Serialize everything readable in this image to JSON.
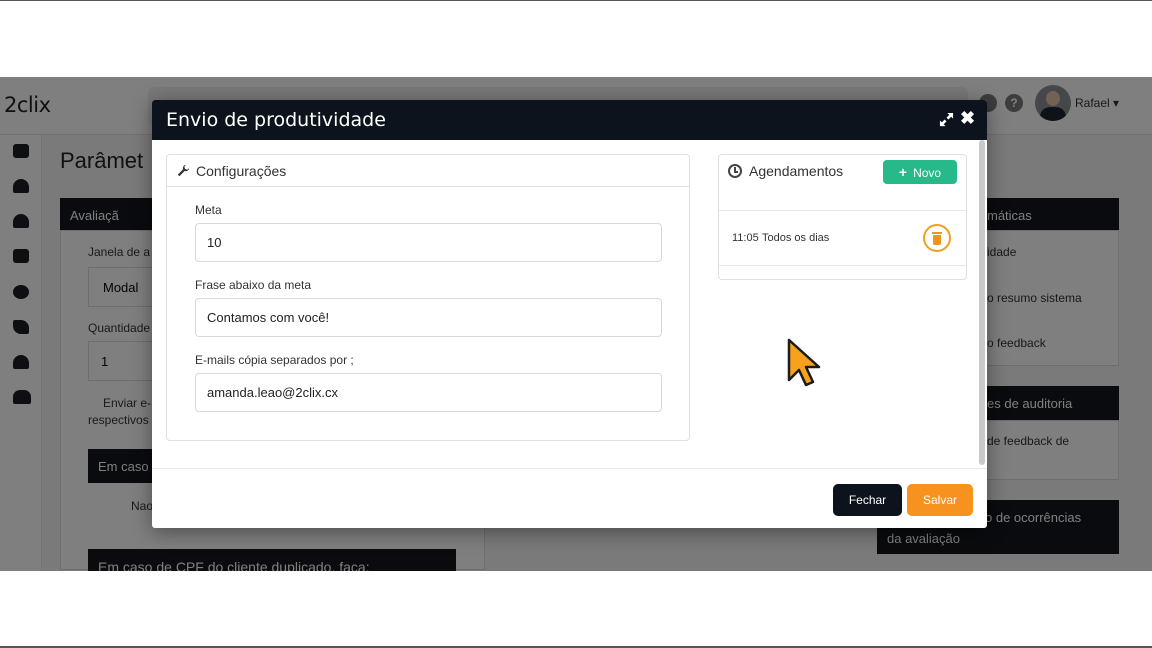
{
  "app": {
    "logo": "2clix",
    "user_name": "Rafael ▾",
    "page_title": "Parâmet",
    "help_icon": "?"
  },
  "background": {
    "left_panel_head": "Avaliaçã",
    "left_label_1": "Janela de a",
    "left_select_value": "Modal",
    "left_label_2": "Quantidade",
    "left_input_value": "1",
    "left_checkbox_text_1": "Enviar e-",
    "left_checkbox_text_2": "respectivos",
    "left_sub_head": "Em caso",
    "left_radio_label": "Nao",
    "left_bottom_head": "Em caso de CPF do cliente duplicado, faça:",
    "right_panel_head_1": "máticas",
    "right_item_1": "idade",
    "right_item_2": "o resumo sistema",
    "right_item_3": "o feedback",
    "right_panel_head_2": "es de auditoria",
    "right_item_4": "de feedback de",
    "right_panel_head_3_line1": "o de ocorrências",
    "right_panel_head_3_line2": "da avaliação"
  },
  "modal": {
    "title": "Envio de produtividade",
    "config": {
      "header": "Configurações",
      "meta_label": "Meta",
      "meta_value": "10",
      "phrase_label": "Frase abaixo da meta",
      "phrase_value": "Contamos com você!",
      "emails_label": "E-mails cópia separados por ;",
      "emails_value": "amanda.leao@2clix.cx"
    },
    "schedules": {
      "header": "Agendamentos",
      "new_label": "Novo",
      "items": [
        {
          "time": "11:05",
          "frequency": "Todos os dias"
        }
      ]
    },
    "footer": {
      "close_label": "Fechar",
      "save_label": "Salvar"
    }
  },
  "colors": {
    "header_dark": "#0d131d",
    "accent_green": "#28b98a",
    "accent_orange": "#f7921e"
  }
}
